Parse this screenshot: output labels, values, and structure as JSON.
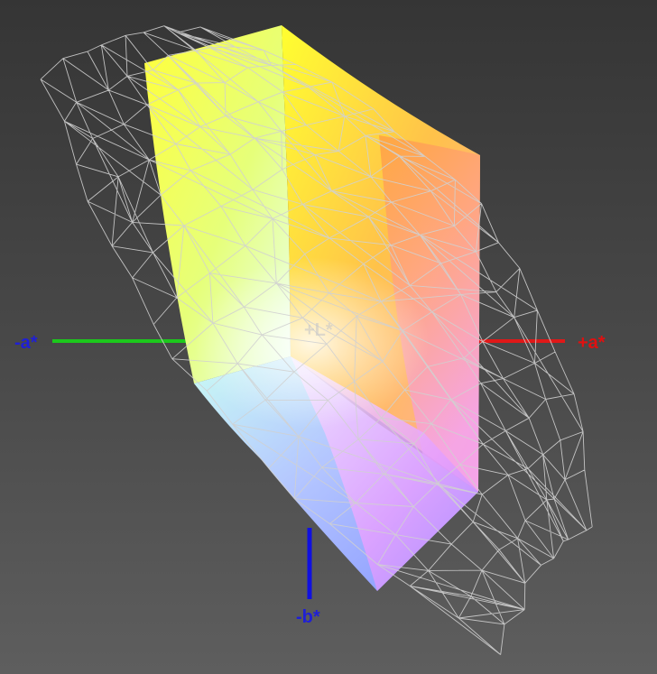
{
  "axes": {
    "neg_a": {
      "label": "-a*",
      "color": "#1f1fd6"
    },
    "pos_a": {
      "label": "+a*",
      "color": "#e01010"
    },
    "neg_b": {
      "label": "-b*",
      "color": "#1f1fd6"
    },
    "pos_l": {
      "label": "+L*",
      "color": "#c8c8c8"
    }
  },
  "line_colors": {
    "neg_a_axis": "#1cc81c",
    "pos_a_axis": "#e01818",
    "neg_b_axis": "#1010e0"
  },
  "wireframe_color": "#d0d0d0",
  "gamut_colors": {
    "top_yellow": "#ffff2a",
    "orange": "#ff9a3a",
    "red_edge": "#ff7060",
    "green_left": "#b8ff70",
    "cyan": "#d6fffb",
    "magenta": "#e88cff",
    "blue": "#8a9cff",
    "center_white": "#fff6ea"
  }
}
